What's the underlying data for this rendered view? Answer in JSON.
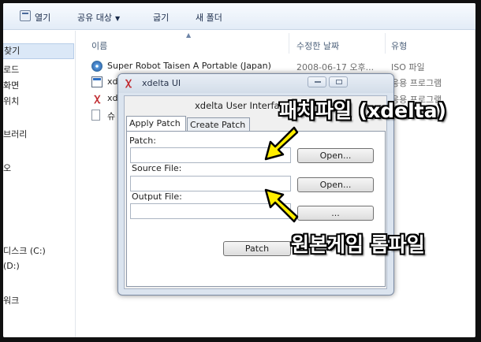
{
  "explorer": {
    "toolbar": {
      "open_label": "열기",
      "share_label": "공유 대상",
      "burn_label": "굽기",
      "new_folder_label": "새 폴더"
    },
    "sidebar": {
      "items": [
        {
          "label": "찾기"
        },
        {
          "label": "로드"
        },
        {
          "label": "화면"
        },
        {
          "label": "위치"
        },
        {
          "label": "브러리"
        },
        {
          "label": "오"
        },
        {
          "label": "디스크 (C:)"
        },
        {
          "label": "(D:)"
        },
        {
          "label": "워크"
        }
      ]
    },
    "columns": {
      "name": "이름",
      "modified": "수정한 날짜",
      "type": "유형"
    },
    "files": [
      {
        "name": "Super Robot Taisen A Portable (Japan)",
        "date": "2008-06-17 오후...",
        "type": "ISO 파일",
        "icon": "disc-icon"
      },
      {
        "name": "xde",
        "date": "",
        "type": "응용 프로그램",
        "icon": "application-icon"
      },
      {
        "name": "xde",
        "date": "",
        "type": "응용 프로그램",
        "icon": "xdelta-icon"
      },
      {
        "name": "슈",
        "date": "",
        "type": "",
        "icon": "document-icon"
      }
    ]
  },
  "dialog": {
    "title": "xdelta UI",
    "heading": "xdelta User Interfa",
    "tabs": [
      "Apply Patch",
      "Create Patch"
    ],
    "patch": {
      "label": "Patch:",
      "value": "",
      "button": "Open..."
    },
    "source": {
      "label": "Source File:",
      "value": "",
      "button": "Open..."
    },
    "output": {
      "label": "Output File:",
      "value": "",
      "button": "..."
    },
    "apply_button": "Patch"
  },
  "annotations": {
    "patch_file": "패치파일 (xdelta)",
    "original_rom": "원본게임 롬파일"
  },
  "colors": {
    "annotation_text": "#ffffff",
    "arrow_fill": "#ffee00",
    "window_frame": "#dbe4ef"
  }
}
